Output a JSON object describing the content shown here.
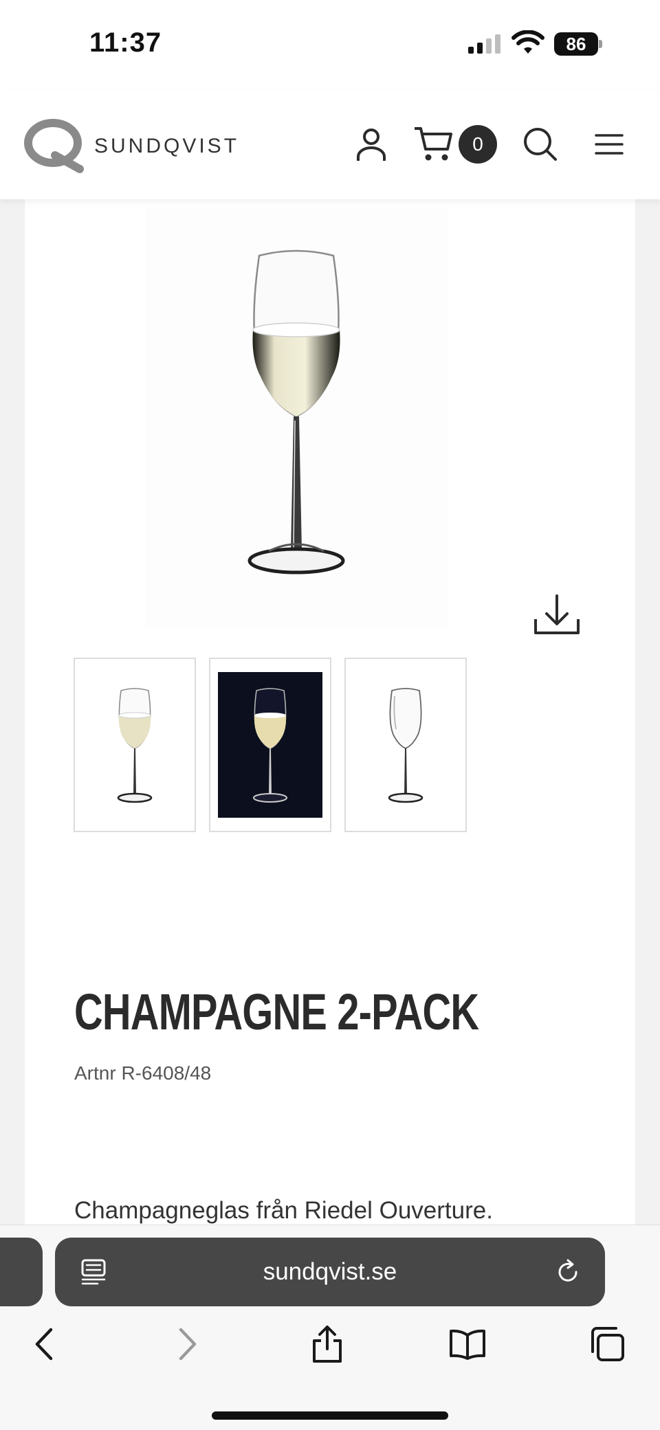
{
  "status_bar": {
    "time": "11:37",
    "battery": "86",
    "icons": [
      "cellular-signal-icon",
      "wifi-icon",
      "battery-icon"
    ]
  },
  "header": {
    "logo_text": "SUNDQVIST",
    "cart_count": "0",
    "icons": [
      "account-icon",
      "cart-icon",
      "search-icon",
      "menu-icon"
    ]
  },
  "product": {
    "title": "CHAMPAGNE 2-PACK",
    "artnr": "Artnr R-6408/48",
    "description": "Champagneglas från Riedel Ouverture.",
    "thumbnails": [
      "champagne-glass-filled",
      "champagne-glass-dark-background",
      "champagne-glass-empty"
    ]
  },
  "browser": {
    "url": "sundqvist.se",
    "icons": [
      "reader-icon",
      "reload-icon",
      "back-icon",
      "forward-icon",
      "share-icon",
      "bookmarks-icon",
      "tabs-icon"
    ]
  },
  "colors": {
    "text": "#2b2b2b",
    "badge": "#2b2b2b",
    "address_bar": "#474747",
    "page_background": "#f2f2f2"
  }
}
